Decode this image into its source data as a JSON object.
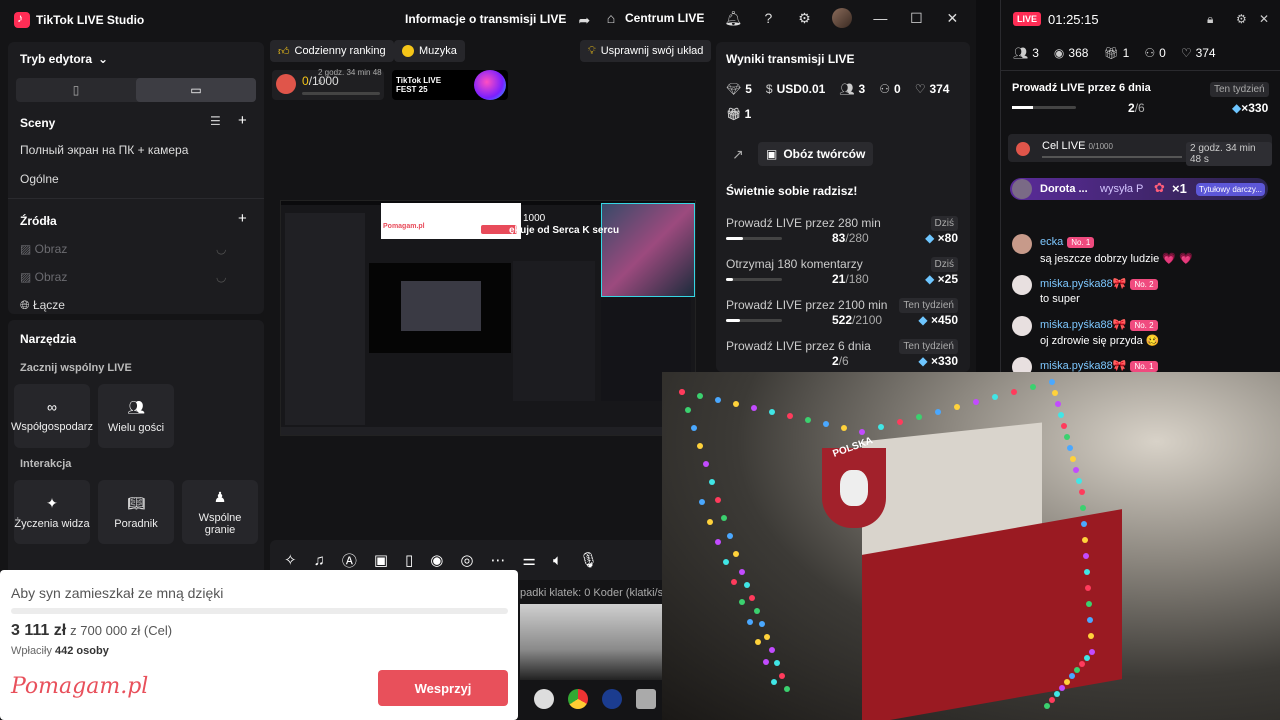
{
  "window": {
    "app_name": "TikTok LIVE Studio",
    "center_title": "Informacje o transmisji LIVE",
    "centrum_label": "Centrum LIVE"
  },
  "left": {
    "mode_label": "Tryb edytora",
    "scenes_title": "Sceny",
    "scenes": [
      "Полный экран на ПК + камера",
      "Ogólne"
    ],
    "sources_title": "Źródła",
    "sources": [
      "Obraz",
      "Obraz",
      "Łącze"
    ],
    "tools_title": "Narzędzia",
    "collab_title": "Zacznij wspólny LIVE",
    "collab_tools": [
      "Współgospodarz",
      "Wielu gości"
    ],
    "interaction_title": "Interakcja",
    "interaction_tools": [
      "Życzenia widza",
      "Poradnik",
      "Wspólne granie"
    ]
  },
  "center": {
    "chips": [
      "Codzienny ranking",
      "Muzyka",
      "Usprawnij swój układ"
    ],
    "goal": {
      "value": "0",
      "total": "/1000",
      "small": "2 godz. 34 min 48 s"
    },
    "fest_label": "TikTok LIVE FEST 25",
    "preview_text1": "1000",
    "preview_text2": "ękuje od Serca K sercu",
    "preview_card_brand": "Pomagam.pl",
    "stats_line": "padki klatek:  0    Koder (klatki/s"
  },
  "results": {
    "title": "Wyniki transmisji LIVE",
    "stats": {
      "diamonds": "5",
      "usd": "USD0.01",
      "viewers": "3",
      "new_followers": "0",
      "likes": "374"
    },
    "gifts": "1",
    "camp_button": "Obóz twórców",
    "subtitle": "Świetnie sobie radzisz!",
    "tasks": [
      {
        "name": "Prowadź LIVE przez 280 min",
        "tag": "Dziś",
        "progress": "83",
        "total": "/280",
        "reward": "×80",
        "fraction": 0.3
      },
      {
        "name": "Otrzymaj 180 komentarzy",
        "tag": "Dziś",
        "progress": "21",
        "total": "/180",
        "reward": "×25",
        "fraction": 0.12
      },
      {
        "name": "Prowadź LIVE przez 2100 min",
        "tag": "Ten tydzień",
        "progress": "522",
        "total": "/2100",
        "reward": "×450",
        "fraction": 0.25
      },
      {
        "name": "Prowadź LIVE przez 6 dnia",
        "tag": "Ten tydzień",
        "progress": "2",
        "total": "/6",
        "reward": "×330",
        "fraction": 0.33
      }
    ]
  },
  "live": {
    "badge": "LIVE",
    "time": "01:25:15",
    "counts": {
      "viewers": "3",
      "views": "368",
      "gifts": "1",
      "followers": "0",
      "likes": "374"
    },
    "task": {
      "name": "Prowadź LIVE przez 6 dnia",
      "tag": "Ten tydzień",
      "progress": "2",
      "total": "/6",
      "reward": "×330",
      "fraction": 0.33
    },
    "cel": {
      "label": "Cel LIVE",
      "value": "0/1000",
      "time": "2 godz. 34 min 48 s"
    },
    "gift_banner": {
      "name": "Dorota ...",
      "action": "wysyła P",
      "count": "×1",
      "tag": "Tytułowy darczy..."
    },
    "messages": [
      {
        "user": "ecka",
        "level": "No. 1",
        "text": "są jeszcze dobrzy ludzie 💗 💗"
      },
      {
        "user": "miśka.pyśka88🎀",
        "level": "No. 2",
        "text": "to super"
      },
      {
        "user": "miśka.pyśka88🎀",
        "level": "No. 2",
        "text": "oj zdrowie się przyda 🥴"
      },
      {
        "user": "miśka.pyśka88🎀",
        "level": "No. 1",
        "text": ""
      }
    ]
  },
  "camera": {
    "flag_text": "POLSKA"
  },
  "donate": {
    "title": "Aby syn zamieszkał ze mną dzięki",
    "amount": "3 111 zł",
    "goal": "z 700 000 zł (Cel)",
    "donors_prefix": "Wpłaciły",
    "donors_count": "442 osoby",
    "brand": "Pomagam.pl",
    "button": "Wesprzyj"
  }
}
